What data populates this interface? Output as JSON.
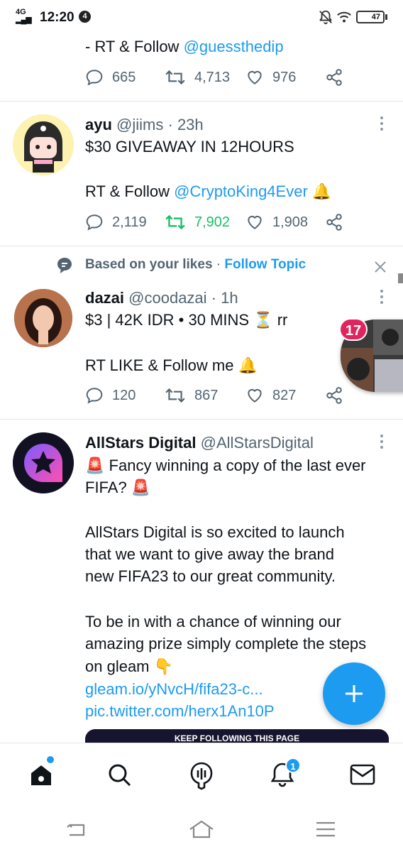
{
  "status_bar": {
    "network": "4G",
    "time": "12:20",
    "notification_count": "4",
    "battery": "47"
  },
  "tweets": [
    {
      "text_line": "- RT & Follow",
      "mention": "@guessthedip",
      "replies": "665",
      "retweets": "4,713",
      "likes": "976"
    },
    {
      "name": "ayu",
      "handle": "@jiims",
      "time": "· 23h",
      "line1": "$30 GIVEAWAY IN 12HOURS",
      "line2_prefix": "RT & Follow",
      "mention": "@CryptoKing4Ever",
      "emoji": "🔔",
      "replies": "2,119",
      "retweets": "7,902",
      "likes": "1,908"
    },
    {
      "context_label": "Based on your likes",
      "context_sep": "·",
      "context_action": "Follow Topic",
      "name": "dazai",
      "handle": "@coodazai",
      "time": "· 1h",
      "line1_prefix": "$3 | 42K IDR • 30 MINS",
      "line1_emoji": "⏳",
      "line1_suffix": "rr",
      "line2_prefix": "RT LIKE & Follow me",
      "line2_emoji": "🔔",
      "replies": "120",
      "retweets": "867",
      "likes": "827"
    },
    {
      "name": "AllStars Digital",
      "handle": "@AllStarsDigital",
      "emoji_alarm": "🚨",
      "line1": "Fancy winning a copy of the last ever",
      "line2": "FIFA?",
      "para2_line1": "AllStars Digital is so excited to launch",
      "para2_line2": "that we want to give away the brand",
      "para2_line3": "new FIFA23 to our great community.",
      "para3_line1": "To be in with a chance of winning our",
      "para3_line2": "amazing prize simply complete the steps",
      "para3_line3": "on gleam",
      "point_emoji": "👇",
      "link1": "gleam.io/yNvcH/fifa23-c...",
      "link2": "pic.twitter.com/herx1An10P",
      "media_caption": "KEEP FOLLOWING THIS PAGE"
    }
  ],
  "floating_bubble": {
    "badge": "17"
  },
  "bottom_nav": {
    "notifications_badge": "1"
  },
  "colors": {
    "accent": "#1d9bf0",
    "retweet_active": "#17bf63",
    "muted": "#536471"
  }
}
